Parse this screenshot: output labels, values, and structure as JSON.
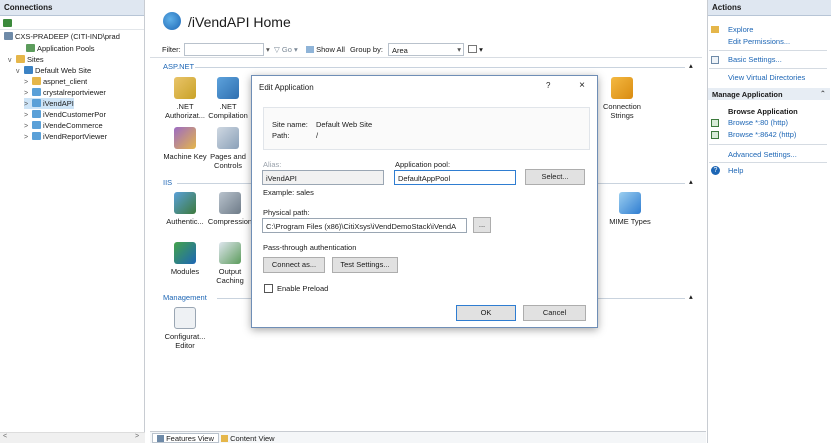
{
  "connections": {
    "header": "Connections",
    "tree": [
      {
        "label": "CXS-PRADEEP (CITI-IND\\prad",
        "chev": "v"
      },
      {
        "label": "Application Pools",
        "chev": ""
      },
      {
        "label": "Sites",
        "chev": "v"
      },
      {
        "label": "Default Web Site",
        "chev": "v"
      },
      {
        "label": "aspnet_client",
        "chev": ">"
      },
      {
        "label": "crystalreportviewer",
        "chev": ">"
      },
      {
        "label": "iVendAPI",
        "chev": ">"
      },
      {
        "label": "iVendCustomerPor",
        "chev": ">"
      },
      {
        "label": "iVendeCommerce",
        "chev": ">"
      },
      {
        "label": "iVendReportViewer",
        "chev": ">"
      }
    ]
  },
  "main": {
    "title": "/iVendAPI Home",
    "filter_label": "Filter:",
    "go_label": "Go",
    "show_all_label": "Show All",
    "group_by_label": "Group by:",
    "group_by_value": "Area",
    "sections": {
      "aspnet": "ASP.NET",
      "iis": "IIS",
      "management": "Management"
    },
    "features": {
      "net_authorization": ".NET\nAuthorizat...",
      "net_compilation": ".NET\nCompilation",
      "connection_strings": "Connection\nStrings",
      "machine_key": "Machine Key",
      "pages_controls": "Pages and\nControls",
      "authentication": "Authentic...",
      "compression": "Compression",
      "mime_types": "MIME Types",
      "modules": "Modules",
      "output_caching": "Output\nCaching",
      "config_editor": "Configurat...\nEditor"
    },
    "bottom_tabs": {
      "features_view": "Features View",
      "content_view": "Content View"
    }
  },
  "actions": {
    "header": "Actions",
    "explore": "Explore",
    "edit_permissions": "Edit Permissions...",
    "basic_settings": "Basic Settings...",
    "view_virtual_dirs": "View Virtual Directories",
    "manage_application": "Manage Application",
    "browse_application": "Browse Application",
    "browse_80": "Browse *:80 (http)",
    "browse_8642": "Browse *:8642 (http)",
    "advanced_settings": "Advanced Settings...",
    "help": "Help"
  },
  "dialog": {
    "title": "Edit Application",
    "help_glyph": "?",
    "close_glyph": "×",
    "site_name_label": "Site name:",
    "site_name_value": "Default Web Site",
    "path_label": "Path:",
    "path_value": "/",
    "alias_label": "Alias:",
    "alias_value": "iVendAPI",
    "example_text": "Example: sales",
    "app_pool_label": "Application pool:",
    "app_pool_value": "DefaultAppPool",
    "select_button": "Select...",
    "physical_path_label": "Physical path:",
    "physical_path_value": "C:\\Program Files (x86)\\CitiXsys\\iVendDemoStack\\iVendA",
    "browse_button": "...",
    "passthrough_label": "Pass-through authentication",
    "connect_as_button": "Connect as...",
    "test_settings_button": "Test Settings...",
    "enable_preload_label": "Enable Preload",
    "ok_button": "OK",
    "cancel_button": "Cancel"
  },
  "colors": {
    "accent": "#1d66b5",
    "selection": "#cde4f7",
    "panel_header": "#dfe7f1"
  }
}
